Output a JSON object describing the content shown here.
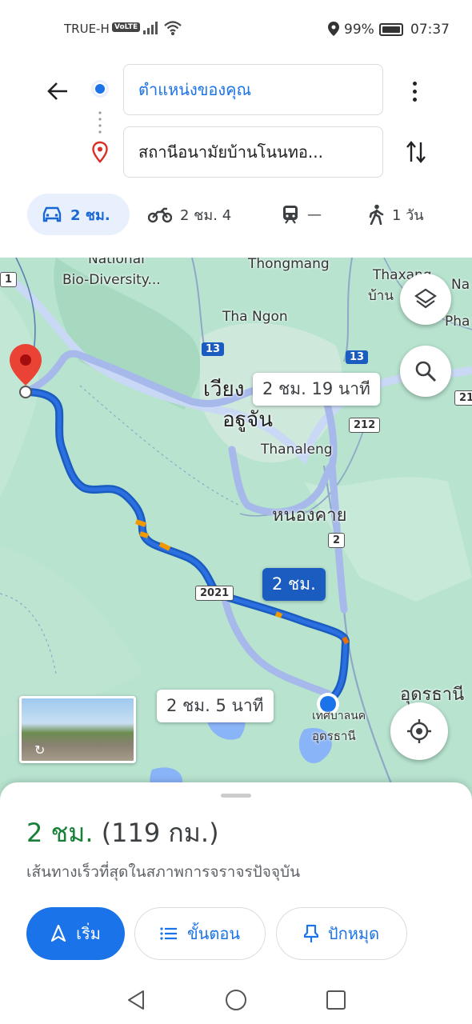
{
  "status_bar": {
    "carrier": "TRUE-H",
    "volte": "VoLTE",
    "battery": "99%",
    "time": "07:37"
  },
  "header": {
    "origin": "ตำแหน่งของคุณ",
    "destination": "สถานีอนามัยบ้านโนนทอ..."
  },
  "modes": [
    {
      "name": "car",
      "label": "2 ชม.",
      "selected": true
    },
    {
      "name": "motorcycle",
      "label": "2 ชม. 4",
      "selected": false
    },
    {
      "name": "transit",
      "label": "—",
      "selected": false
    },
    {
      "name": "walk",
      "label": "1 วัน",
      "selected": false
    }
  ],
  "map": {
    "labels": {
      "national": "National",
      "biodiversity": "Bio-Diversity...",
      "thongmang": "Thongmang",
      "thaxang": "Thaxang",
      "thaxang_thai": "บ้าน",
      "na": "Na",
      "pha": "Pha",
      "thangon": "Tha Ngon",
      "vientiane_lao1": "เวียง",
      "vientiane_lao2": "อฐูจัน",
      "thanaleng": "Thanaleng",
      "nongkhai": "หนองคาย",
      "udon_label": "เทศบาลนค",
      "udon_label2": "อุดรธานี",
      "udon_edge": "อุดรธานี"
    },
    "shields": {
      "r13a": "13",
      "r13b": "13",
      "r212": "212",
      "r2": "2",
      "r2021": "2021",
      "r21": "21",
      "r1": "1"
    },
    "callouts": {
      "alt1": "2 ชม. 19 นาที",
      "main": "2 ชม.",
      "alt2": "2 ชม. 5 นาที"
    },
    "route_color": "#1a5cbf",
    "alt_route_color": "#a6b9ea"
  },
  "sheet": {
    "duration": "2 ชม.",
    "distance": "(119 กม.)",
    "subtitle": "เส้นทางเร็วที่สุดในสภาพการจราจรปัจจุบัน",
    "start": "เริ่ม",
    "steps": "ขั้นตอน",
    "pin": "ปักหมุด"
  }
}
